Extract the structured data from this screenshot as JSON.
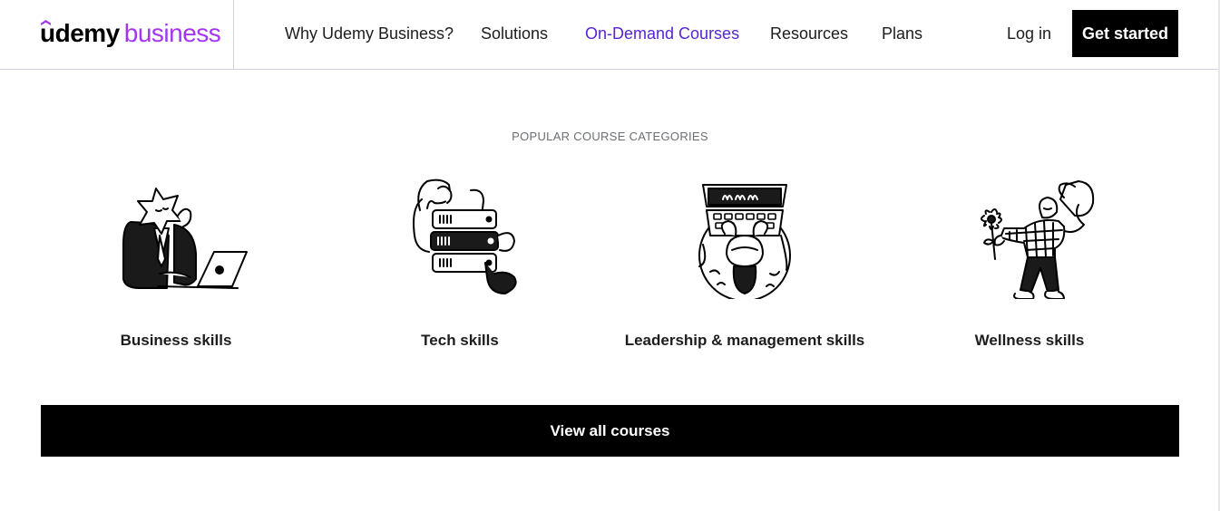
{
  "brand": {
    "name_primary": "ūdemy",
    "name_secondary": "business",
    "accent_color": "#a435f0"
  },
  "nav": {
    "items": [
      {
        "label": "Why Udemy Business?",
        "active": false
      },
      {
        "label": "Solutions",
        "active": false
      },
      {
        "label": "On-Demand Courses",
        "active": true
      },
      {
        "label": "Resources",
        "active": false
      },
      {
        "label": "Plans",
        "active": false
      }
    ],
    "active_color": "#5624d0",
    "login_label": "Log in",
    "cta_label": "Get started"
  },
  "section": {
    "label": "POPULAR COURSE CATEGORIES",
    "categories": [
      {
        "label": "Business skills",
        "icon": "star-businessperson-laptop-illustration"
      },
      {
        "label": "Tech skills",
        "icon": "server-rack-hands-illustration"
      },
      {
        "label": "Leadership & management skills",
        "icon": "person-at-keyboard-illustration"
      },
      {
        "label": "Wellness skills",
        "icon": "person-drinking-flower-illustration"
      }
    ],
    "view_all_label": "View all courses"
  }
}
